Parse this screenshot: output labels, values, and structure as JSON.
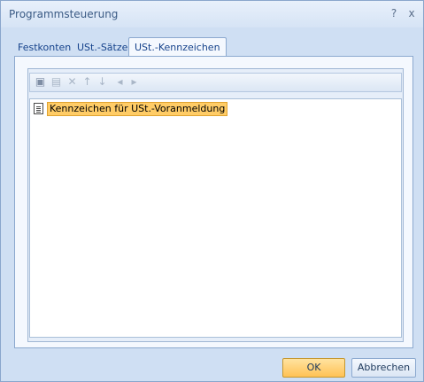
{
  "window": {
    "title": "Programmsteuerung",
    "help": "?",
    "close": "x"
  },
  "tabs": [
    {
      "label": "Festkonten"
    },
    {
      "label": "USt.-Sätze"
    },
    {
      "label": "USt.-Kennzeichen"
    }
  ],
  "tree": {
    "items": [
      {
        "label": "Kennzeichen für USt.-Voranmeldung"
      }
    ]
  },
  "buttons": {
    "ok": "OK",
    "cancel": "Abbrechen"
  },
  "toolbar_icons": [
    "new-icon",
    "edit-icon",
    "delete-icon",
    "arrow-up-icon",
    "arrow-down-icon",
    "arrow-left-icon",
    "arrow-right-icon"
  ],
  "colors": {
    "selection": "#ffcc66",
    "ok_button": "#ffc255",
    "frame": "#cfdff3"
  }
}
